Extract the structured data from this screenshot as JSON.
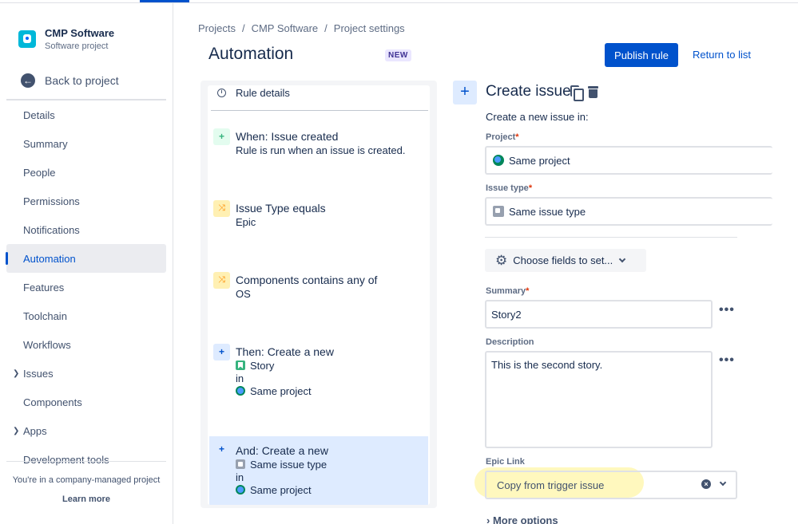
{
  "sidebar": {
    "project_name": "CMP Software",
    "project_type": "Software project",
    "back_label": "Back to project",
    "items": [
      {
        "label": "Details"
      },
      {
        "label": "Summary"
      },
      {
        "label": "People"
      },
      {
        "label": "Permissions"
      },
      {
        "label": "Notifications"
      },
      {
        "label": "Automation",
        "active": true
      },
      {
        "label": "Features"
      },
      {
        "label": "Toolchain"
      },
      {
        "label": "Workflows"
      },
      {
        "label": "Issues",
        "expandable": true
      },
      {
        "label": "Components"
      },
      {
        "label": "Apps",
        "expandable": true
      },
      {
        "label": "Development tools"
      }
    ],
    "footer_note": "You're in a company-managed project",
    "learn_more": "Learn more"
  },
  "breadcrumb": [
    "Projects",
    "/",
    "CMP Software",
    "/",
    "Project settings"
  ],
  "header": {
    "title": "Automation",
    "badge": "NEW",
    "publish_label": "Publish rule",
    "return_label": "Return to list"
  },
  "rule": {
    "details_label": "Rule details",
    "trigger": {
      "title": "When: Issue created",
      "sub": "Rule is run when an issue is created."
    },
    "condition1": {
      "title": "Issue Type equals",
      "sub": "Epic"
    },
    "condition2": {
      "title": "Components contains any of",
      "sub": "OS"
    },
    "action1": {
      "title": "Then: Create a new",
      "type": "Story",
      "in": "in",
      "project": "Same project"
    },
    "action2": {
      "title": "And: Create a new",
      "type": "Same issue type",
      "in": "in",
      "project": "Same project"
    }
  },
  "config": {
    "add_symbol": "+",
    "title": "Create issue",
    "description": "Create a new issue in:",
    "project_label": "Project",
    "project_value": "Same project",
    "issue_type_label": "Issue type",
    "issue_type_value": "Same issue type",
    "choose_fields_label": "Choose fields to set...",
    "summary_label": "Summary",
    "summary_value": "Story2",
    "description_label": "Description",
    "description_value": "This is the second story.",
    "epic_link_label": "Epic Link",
    "epic_link_value": "Copy from trigger issue",
    "more_options_label": "More options",
    "required_marker": "*"
  },
  "colors": {
    "accent": "#0052cc",
    "highlight": "#fff5a8"
  }
}
